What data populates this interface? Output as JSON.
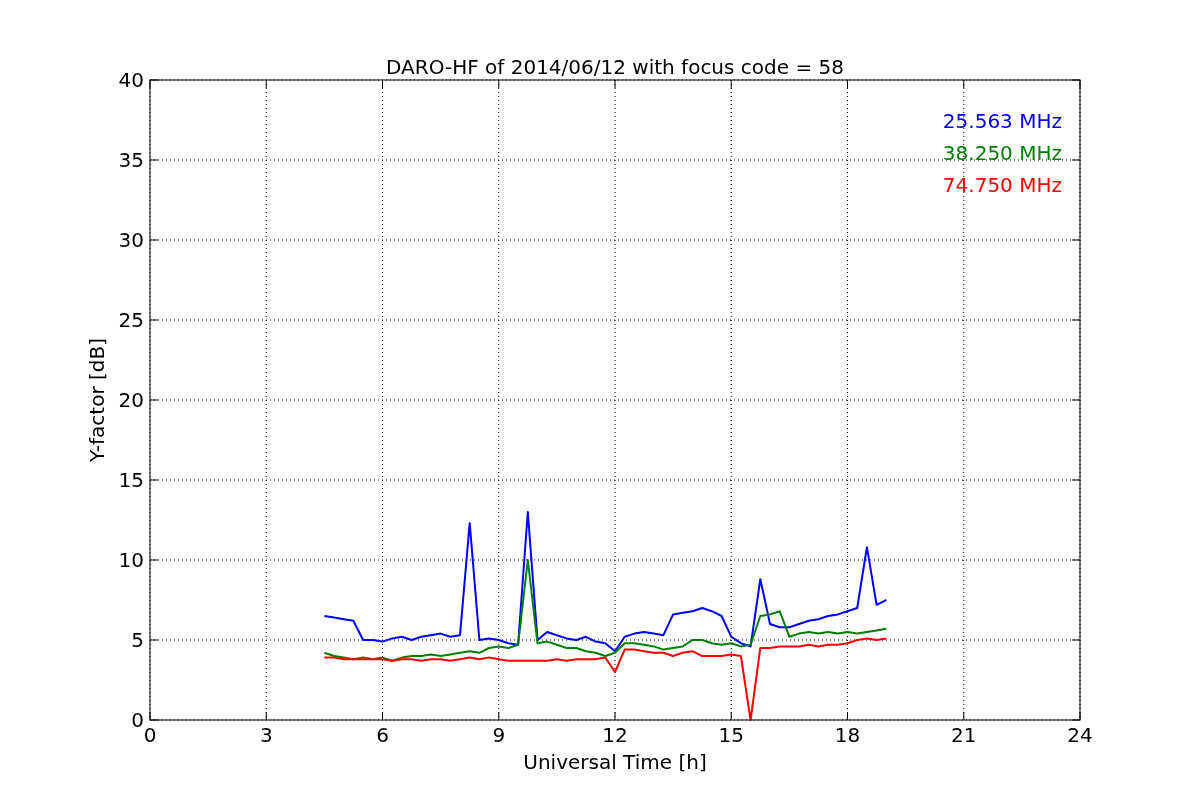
{
  "chart_data": {
    "type": "line",
    "title": "DARO-HF of 2014/06/12 with focus code = 58",
    "xlabel": "Universal Time [h]",
    "ylabel": "Y-factor [dB]",
    "xlim": [
      0,
      24
    ],
    "ylim": [
      0,
      40
    ],
    "xticks": [
      0,
      3,
      6,
      9,
      12,
      15,
      18,
      21,
      24
    ],
    "yticks": [
      0,
      5,
      10,
      15,
      20,
      25,
      30,
      35,
      40
    ],
    "grid": true,
    "x": [
      4.5,
      4.75,
      5.0,
      5.25,
      5.5,
      5.75,
      6.0,
      6.25,
      6.5,
      6.75,
      7.0,
      7.25,
      7.5,
      7.75,
      8.0,
      8.25,
      8.5,
      8.75,
      9.0,
      9.25,
      9.5,
      9.75,
      10.0,
      10.25,
      10.5,
      10.75,
      11.0,
      11.25,
      11.5,
      11.75,
      12.0,
      12.25,
      12.5,
      12.75,
      13.0,
      13.25,
      13.5,
      13.75,
      14.0,
      14.25,
      14.5,
      14.75,
      15.0,
      15.25,
      15.5,
      15.75,
      16.0,
      16.25,
      16.5,
      16.75,
      17.0,
      17.25,
      17.5,
      17.75,
      18.0,
      18.25,
      18.5,
      18.75,
      19.0
    ],
    "series": [
      {
        "name": "25.563 MHz",
        "color": "#0000ff",
        "values": [
          6.5,
          6.4,
          6.3,
          6.2,
          5.0,
          5.0,
          4.9,
          5.1,
          5.2,
          5.0,
          5.2,
          5.3,
          5.4,
          5.2,
          5.3,
          12.3,
          5.0,
          5.1,
          5.0,
          4.8,
          4.7,
          13.0,
          5.0,
          5.5,
          5.3,
          5.1,
          5.0,
          5.2,
          4.9,
          4.8,
          4.3,
          5.2,
          5.4,
          5.5,
          5.4,
          5.3,
          6.6,
          6.7,
          6.8,
          7.0,
          6.8,
          6.5,
          5.2,
          4.8,
          4.6,
          8.8,
          6.0,
          5.8,
          5.8,
          6.0,
          6.2,
          6.3,
          6.5,
          6.6,
          6.8,
          7.0,
          10.8,
          7.2,
          7.5
        ]
      },
      {
        "name": "38.250 MHz",
        "color": "#008000",
        "values": [
          4.2,
          4.0,
          3.9,
          3.8,
          3.9,
          3.8,
          3.9,
          3.7,
          3.9,
          4.0,
          4.0,
          4.1,
          4.0,
          4.1,
          4.2,
          4.3,
          4.2,
          4.5,
          4.6,
          4.5,
          4.7,
          10.0,
          4.8,
          4.9,
          4.7,
          4.5,
          4.5,
          4.3,
          4.2,
          4.0,
          4.2,
          4.8,
          4.8,
          4.7,
          4.6,
          4.4,
          4.5,
          4.6,
          5.0,
          5.0,
          4.8,
          4.7,
          4.8,
          4.6,
          4.7,
          6.5,
          6.6,
          6.8,
          5.2,
          5.4,
          5.5,
          5.4,
          5.5,
          5.4,
          5.5,
          5.4,
          5.5,
          5.6,
          5.7
        ]
      },
      {
        "name": "74.750 MHz",
        "color": "#ff0000",
        "values": [
          3.9,
          3.9,
          3.8,
          3.8,
          3.8,
          3.8,
          3.8,
          3.7,
          3.8,
          3.8,
          3.7,
          3.8,
          3.8,
          3.7,
          3.8,
          3.9,
          3.8,
          3.9,
          3.8,
          3.7,
          3.7,
          3.7,
          3.7,
          3.7,
          3.8,
          3.7,
          3.8,
          3.8,
          3.8,
          3.9,
          3.0,
          4.4,
          4.4,
          4.3,
          4.2,
          4.2,
          4.0,
          4.2,
          4.3,
          4.0,
          4.0,
          4.0,
          4.1,
          4.0,
          0,
          4.5,
          4.5,
          4.6,
          4.6,
          4.6,
          4.7,
          4.6,
          4.7,
          4.7,
          4.8,
          5.0,
          5.1,
          5.0,
          5.1
        ]
      }
    ]
  }
}
